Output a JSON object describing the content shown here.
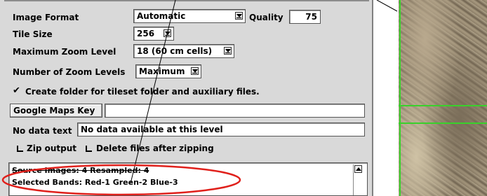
{
  "form": {
    "image_format_label": "Image Format",
    "image_format_value": "Automatic",
    "quality_label": "Quality",
    "quality_value": "75",
    "tile_size_label": "Tile Size",
    "tile_size_value": "256",
    "max_zoom_label": "Maximum Zoom Level",
    "max_zoom_value": "18 (60 cm cells)",
    "num_zoom_label": "Number of Zoom Levels",
    "num_zoom_value": "Maximum",
    "create_folder_label": "Create folder for tileset folder and auxiliary files.",
    "create_folder_checked": true,
    "google_maps_key_button": "Google Maps Key",
    "google_maps_key_value": "",
    "no_data_label": "No data text",
    "no_data_value": "No data available at this level",
    "zip_output_label": "Zip output",
    "delete_files_label": "Delete files after zipping"
  },
  "status": {
    "line1": "Source Images: 4   Resampled: 4",
    "line2": "Selected Bands:  Red-1  Green-2  Blue-3"
  },
  "annotation": {
    "ellipse_color": "#e0201b"
  },
  "map": {
    "grid_color": "#39d12b"
  }
}
